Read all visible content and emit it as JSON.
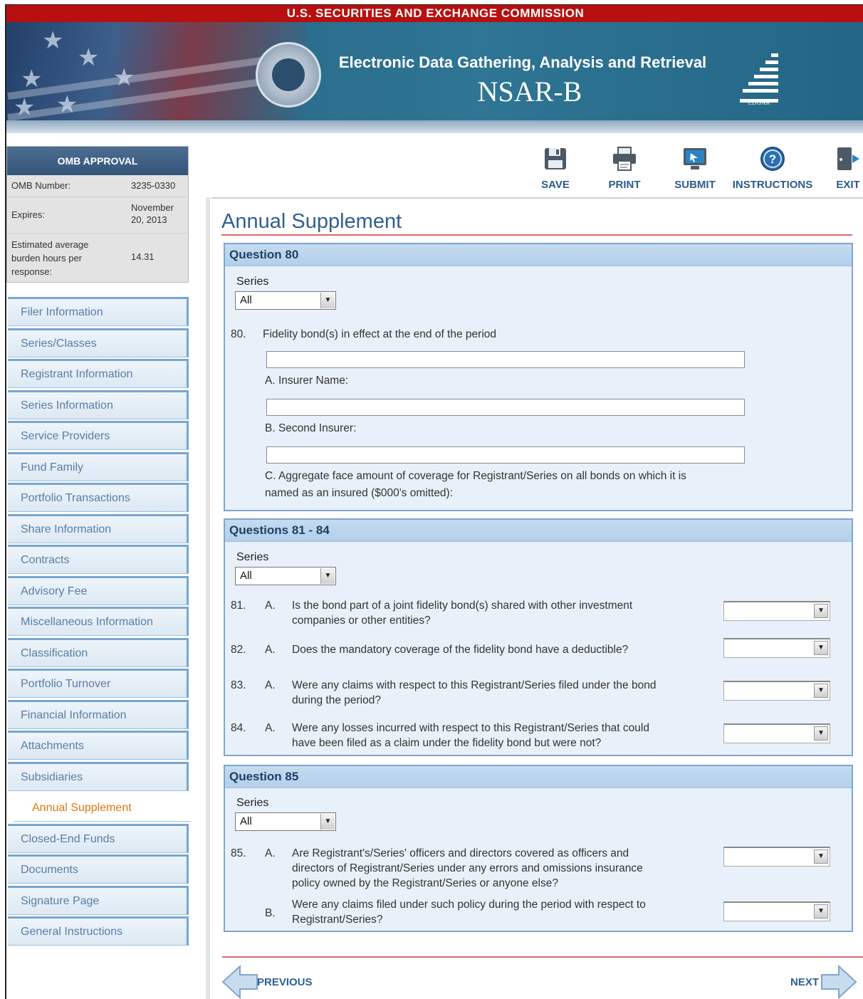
{
  "header": {
    "agency": "U.S. SECURITIES AND EXCHANGE COMMISSION",
    "system": "Electronic Data Gathering, Analysis and Retrieval",
    "form": "NSAR-B",
    "logo_text": "EDGAR"
  },
  "omb": {
    "title": "OMB APPROVAL",
    "number_label": "OMB Number:",
    "number_value": "3235-0330",
    "expires_label": "Expires:",
    "expires_value": "November 20, 2013",
    "burden_label": "Estimated average burden hours per response:",
    "burden_value": "14.31"
  },
  "nav": [
    "Filer Information",
    "Series/Classes",
    "Registrant Information",
    "Series Information",
    "Service Providers",
    "Fund Family",
    "Portfolio Transactions",
    "Share Information",
    "Contracts",
    "Advisory Fee",
    "Miscellaneous Information",
    "Classification",
    "Portfolio Turnover",
    "Financial Information",
    "Attachments",
    "Subsidiaries",
    "Annual Supplement",
    "Closed-End Funds",
    "Documents",
    "Signature Page",
    "General Instructions"
  ],
  "nav_active_index": 16,
  "toolbar": {
    "save": "SAVE",
    "print": "PRINT",
    "submit": "SUBMIT",
    "instructions": "INSTRUCTIONS",
    "exit": "EXIT"
  },
  "page_title": "Annual Supplement",
  "q80": {
    "heading": "Question 80",
    "series_label": "Series",
    "series_value": "All",
    "num": "80.",
    "text": "Fidelity bond(s) in effect at the end of the period",
    "a_label": "A. Insurer Name:",
    "b_label": "B. Second Insurer:",
    "c_label_1": "C. Aggregate face amount of coverage for Registrant/Series on all bonds on which it is",
    "c_label_2": "named as an insured ($000's omitted):",
    "a_value": "",
    "b_value": "",
    "c_value": ""
  },
  "q81_84": {
    "heading": "Questions 81 - 84",
    "series_label": "Series",
    "series_value": "All",
    "items": [
      {
        "num": "81.",
        "letter": "A.",
        "l1": "Is the bond part of a joint fidelity bond(s) shared with other investment",
        "l2": "companies or other entities?"
      },
      {
        "num": "82.",
        "letter": "A.",
        "l1": "Does the mandatory coverage of the fidelity bond have a deductible?",
        "l2": ""
      },
      {
        "num": "83.",
        "letter": "A.",
        "l1": "Were any claims with respect to this Registrant/Series filed under the bond",
        "l2": "during the period?"
      },
      {
        "num": "84.",
        "letter": "A.",
        "l1": "Were any losses incurred with respect to this Registrant/Series that could",
        "l2": "have been filed as a claim under the fidelity bond but were not?"
      }
    ]
  },
  "q85": {
    "heading": "Question 85",
    "series_label": "Series",
    "series_value": "All",
    "num": "85.",
    "a_letter": "A.",
    "a_l1": "Are Registrant's/Series' officers and directors covered as officers and",
    "a_l2": "directors of Registrant/Series under any errors and omissions insurance",
    "a_l3": "policy owned by the Registrant/Series or anyone else?",
    "b_letter": "B.",
    "b_l1": "Were any claims filed under such policy during the period with respect to",
    "b_l2": "Registrant/Series?"
  },
  "footer": {
    "previous": "PREVIOUS",
    "next": "NEXT"
  },
  "colors": {
    "top_red": "#b80f0f",
    "nav_text": "#5a7da6",
    "active_nav": "#e0770f",
    "heading_blue": "#2f5f93"
  }
}
